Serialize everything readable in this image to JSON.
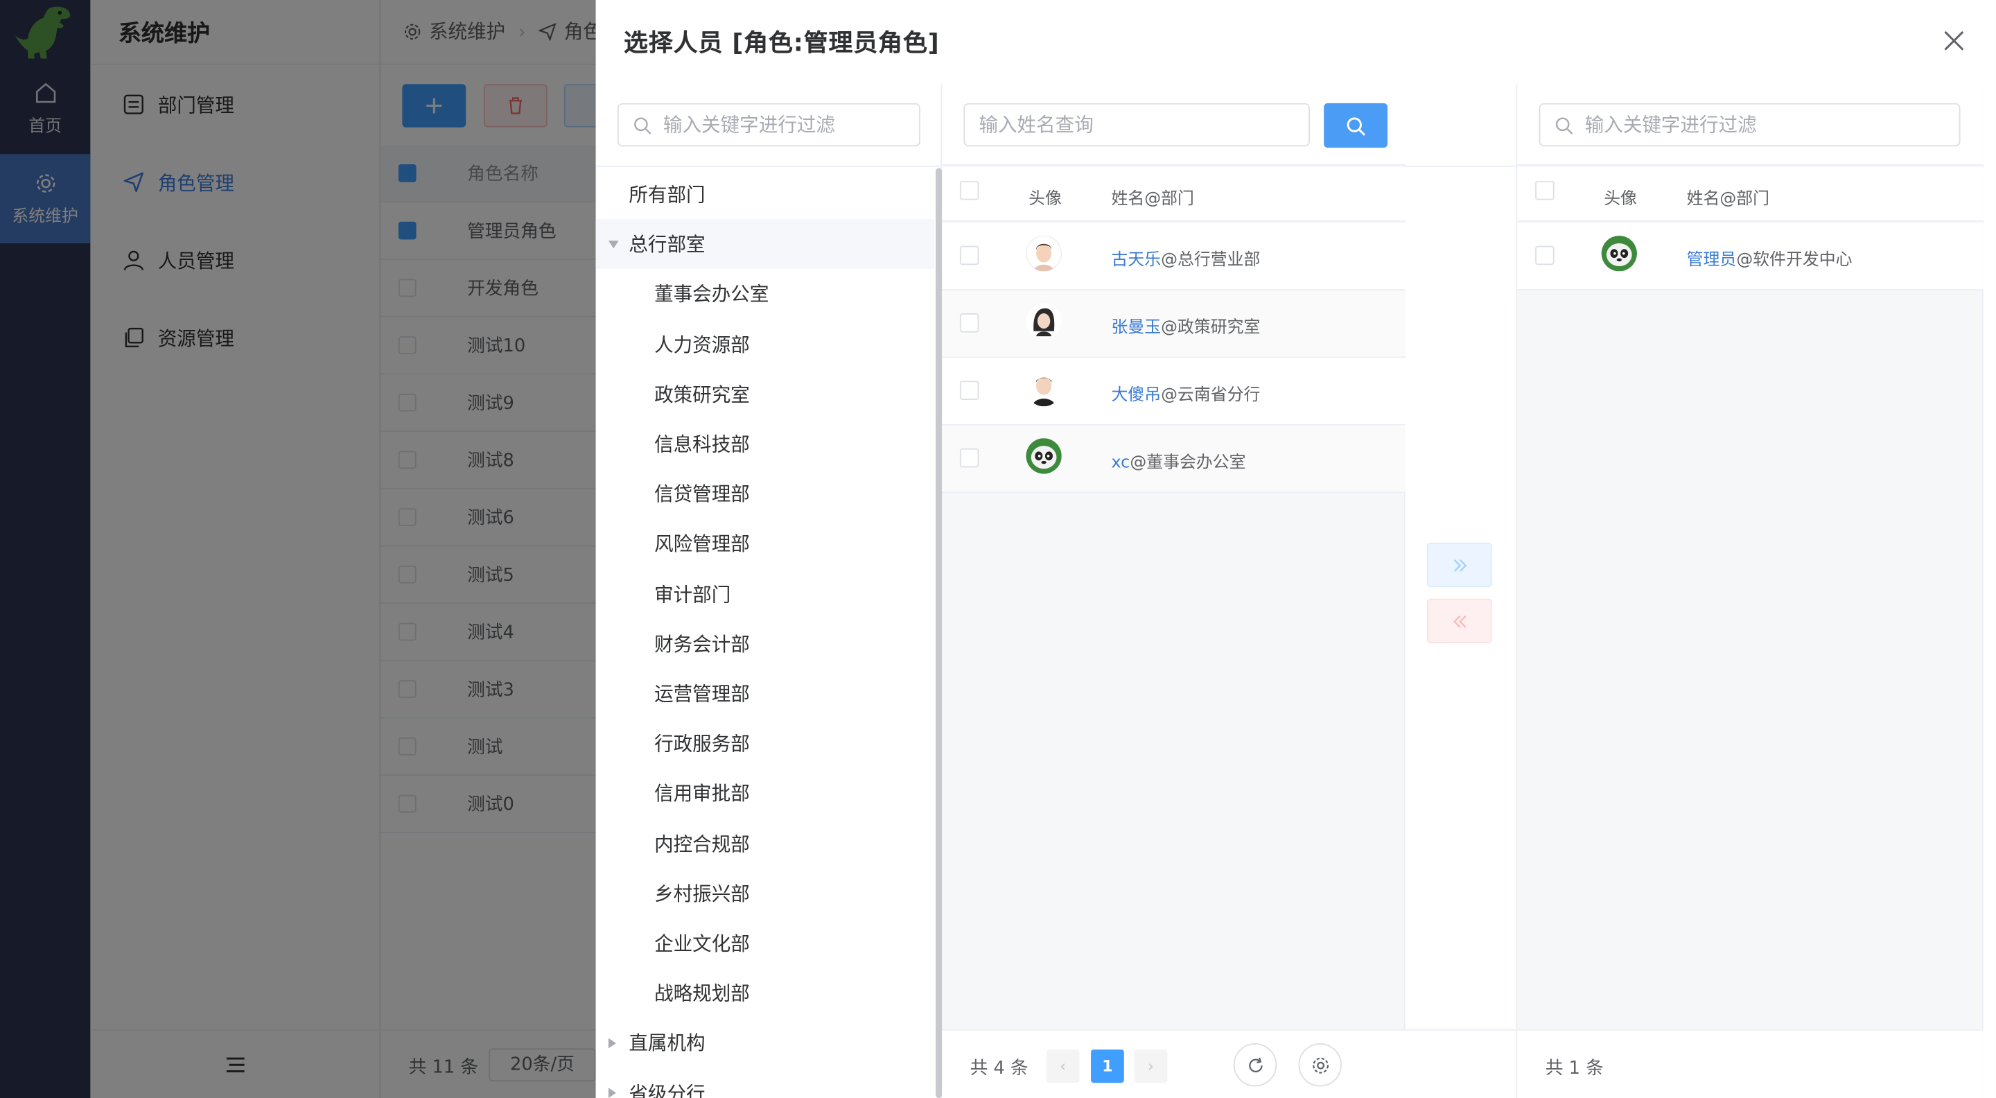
{
  "app": {
    "rail": {
      "home_label": "首页",
      "maintenance_label": "系统维护"
    },
    "sidebar": {
      "title": "系统维护",
      "items": [
        {
          "label": "部门管理"
        },
        {
          "label": "角色管理"
        },
        {
          "label": "人员管理"
        },
        {
          "label": "资源管理"
        }
      ]
    },
    "breadcrumb": {
      "first": "系统维护",
      "second": "角色"
    },
    "role_table": {
      "header": "角色名称",
      "rows": [
        {
          "name": "管理员角色",
          "checked": true
        },
        {
          "name": "开发角色",
          "checked": false
        },
        {
          "name": "测试10",
          "checked": false
        },
        {
          "name": "测试9",
          "checked": false
        },
        {
          "name": "测试8",
          "checked": false
        },
        {
          "name": "测试6",
          "checked": false
        },
        {
          "name": "测试5",
          "checked": false
        },
        {
          "name": "测试4",
          "checked": false
        },
        {
          "name": "测试3",
          "checked": false
        },
        {
          "name": "测试",
          "checked": false
        },
        {
          "name": "测试0",
          "checked": false
        }
      ],
      "total": "共 11 条",
      "page_size": "20条/页"
    }
  },
  "drawer": {
    "title": "选择人员 [角色:管理员角色]",
    "tree": {
      "filter_placeholder": "输入关键字进行过滤",
      "root": "所有部门",
      "expanded_group": "总行部室",
      "children": [
        "董事会办公室",
        "人力资源部",
        "政策研究室",
        "信息科技部",
        "信贷管理部",
        "风险管理部",
        "审计部门",
        "财务会计部",
        "运营管理部",
        "行政服务部",
        "信用审批部",
        "内控合规部",
        "乡村振兴部",
        "企业文化部",
        "战略规划部"
      ],
      "collapsed_groups": [
        "直属机构",
        "省级分行"
      ]
    },
    "people": {
      "search_placeholder": "输入姓名查询",
      "col_avatar": "头像",
      "col_name": "姓名@部门",
      "rows": [
        {
          "name": "古天乐",
          "dept": "@总行营业部",
          "avatar": "avatar-man-icon"
        },
        {
          "name": "张曼玉",
          "dept": "@政策研究室",
          "avatar": "avatar-woman-icon"
        },
        {
          "name": "大傻吊",
          "dept": "@云南省分行",
          "avatar": "avatar-man-dark-icon"
        },
        {
          "name": "xc",
          "dept": "@董事会办公室",
          "avatar": "avatar-panda-icon"
        }
      ],
      "total": "共 4 条",
      "current_page": "1"
    },
    "selected": {
      "filter_placeholder": "输入关键字进行过滤",
      "col_avatar": "头像",
      "col_name": "姓名@部门",
      "rows": [
        {
          "name": "管理员",
          "dept": "@软件开发中心",
          "avatar": "avatar-panda-icon"
        }
      ],
      "total": "共 1 条"
    }
  },
  "colors": {
    "accent": "#409eff",
    "link": "#3a7bd5",
    "rail": "#2f3550",
    "rail_active": "#4a78c4"
  }
}
